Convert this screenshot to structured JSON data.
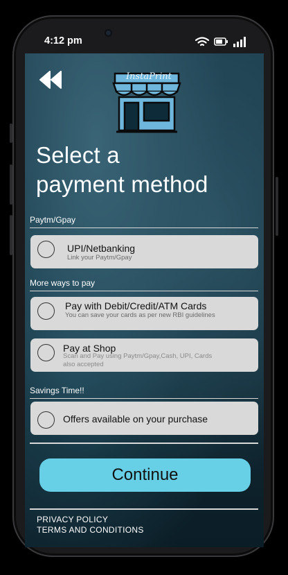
{
  "status_bar": {
    "time": "4:12 pm"
  },
  "header": {
    "logo_text": "InstaPrint",
    "title_line1": "Select a",
    "title_line2": "payment method"
  },
  "sections": {
    "paytm": {
      "label": "Paytm/Gpay"
    },
    "more": {
      "label": "More ways to pay"
    },
    "savings": {
      "label": "Savings Time!!"
    }
  },
  "options": {
    "upi": {
      "title": "UPI/Netbanking",
      "subtitle": "Link your Paytm/Gpay"
    },
    "cards": {
      "title": "Pay with Debit/Credit/ATM Cards",
      "subtitle": "You can save your cards as per new RBI guidelines"
    },
    "shop": {
      "title": "Pay at Shop",
      "subtitle": "Scan and Pay using Paytm/Gpay,Cash, UPI, Cards also accepted"
    },
    "offers": {
      "title": "Offers available on your purchase"
    }
  },
  "continue_label": "Continue",
  "footer": {
    "privacy": "PRIVACY POLICY",
    "terms": "TERMS AND CONDITIONS"
  },
  "colors": {
    "accent": "#67cfe6",
    "card": "#d9d9d9",
    "logo_blue": "#6fb6dd"
  },
  "icons": [
    "back-rewind-icon",
    "store-logo-icon",
    "wifi-icon",
    "battery-icon",
    "signal-icon"
  ]
}
